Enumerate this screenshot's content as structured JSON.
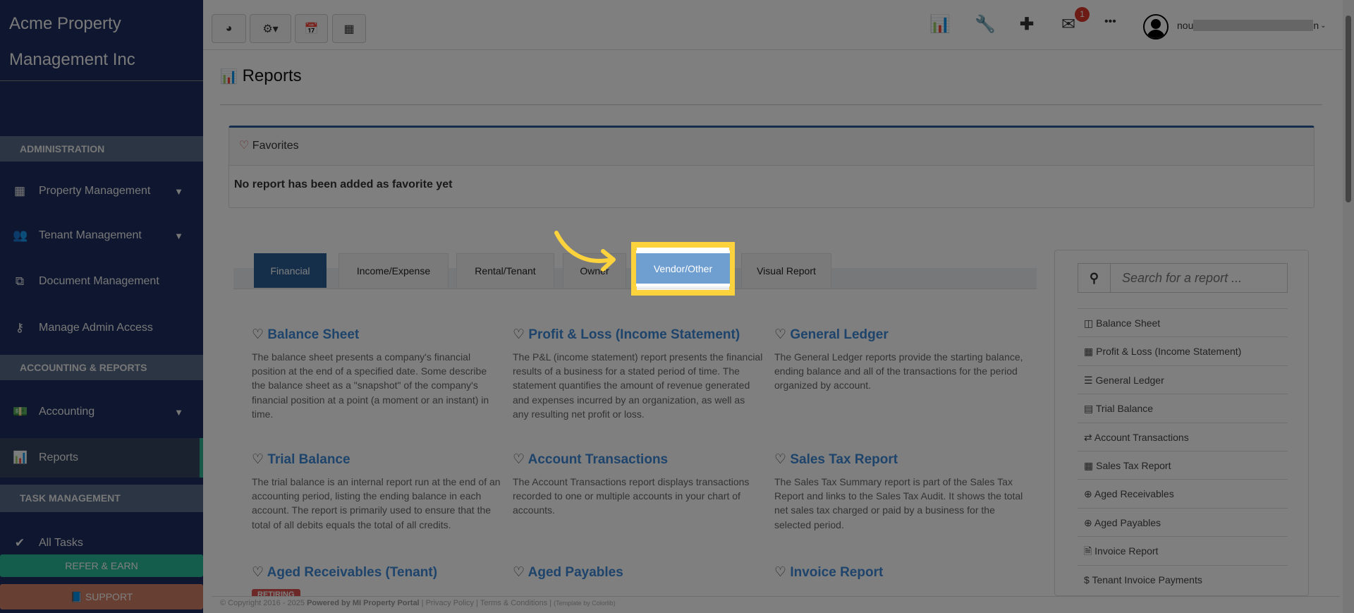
{
  "sidebar": {
    "company": [
      "Acme Property",
      "Management Inc"
    ],
    "sections": {
      "admin": "ADMINISTRATION",
      "accounting": "ACCOUNTING & REPORTS",
      "tasks": "TASK MANAGEMENT"
    },
    "items": {
      "property": "Property Management",
      "tenant": "Tenant Management",
      "document": "Document Management",
      "admin_access": "Manage Admin Access",
      "accounting": "Accounting",
      "reports": "Reports",
      "all_tasks": "All Tasks"
    },
    "refer": "REFER & EARN",
    "support": "SUPPORT"
  },
  "topbar": {
    "mail_count": "1",
    "user_name_prefix": "nou",
    "user_name_suffix": "n"
  },
  "page": {
    "title": "Reports"
  },
  "favorites": {
    "title": "Favorites",
    "empty": "No report has been added as favorite yet"
  },
  "tabs": [
    "Financial",
    "Income/Expense",
    "Rental/Tenant",
    "Owner",
    "Vendor/Other",
    "Visual Report"
  ],
  "cards": [
    {
      "title": "Balance Sheet",
      "desc": "The balance sheet presents a company's financial position at the end of a specified date. Some describe the balance sheet as a \"snapshot\" of the company's financial position at a point (a moment or an instant) in time."
    },
    {
      "title": "Profit & Loss (Income Statement)",
      "desc": "The P&L (income statement) report presents the financial results of a business for a stated period of time. The statement quantifies the amount of revenue generated and expenses incurred by an organization, as well as any resulting net profit or loss."
    },
    {
      "title": "General Ledger",
      "desc": "The General Ledger reports provide the starting balance, ending balance and all of the transactions for the period organized by account."
    },
    {
      "title": "Trial Balance",
      "desc": "The trial balance is an internal report run at the end of an accounting period, listing the ending balance in each account. The report is primarily used to ensure that the total of all debits equals the total of all credits."
    },
    {
      "title": "Account Transactions",
      "desc": "The Account Transactions report displays transactions recorded to one or multiple accounts in your chart of accounts."
    },
    {
      "title": "Sales Tax Report",
      "desc": "The Sales Tax Summary report is part of the Sales Tax Report and links to the Sales Tax Audit. It shows the total net sales tax charged or paid by a business for the selected period."
    },
    {
      "title": "Aged Receivables (Tenant)",
      "badge": "RETIRING"
    },
    {
      "title": "Aged Payables"
    },
    {
      "title": "Invoice Report"
    }
  ],
  "search": {
    "placeholder": "Search for a report ..."
  },
  "quick_list": [
    "Balance Sheet",
    "Profit & Loss (Income Statement)",
    "General Ledger",
    "Trial Balance",
    "Account Transactions",
    "Sales Tax Report",
    "Aged Receivables",
    "Aged Payables",
    "Invoice Report",
    "Tenant Invoice Payments"
  ],
  "footer": {
    "copyright": "© Copyright 2016 - 2025 ",
    "powered": "Powered by MI Property Portal",
    "links": " | Privacy Policy | Terms & Conditions | ",
    "template": "(Template by Colorlib)"
  },
  "colors": {
    "highlight": "#fdd33d",
    "sidebar": "#1f2f60",
    "accent": "#2a5f96"
  }
}
